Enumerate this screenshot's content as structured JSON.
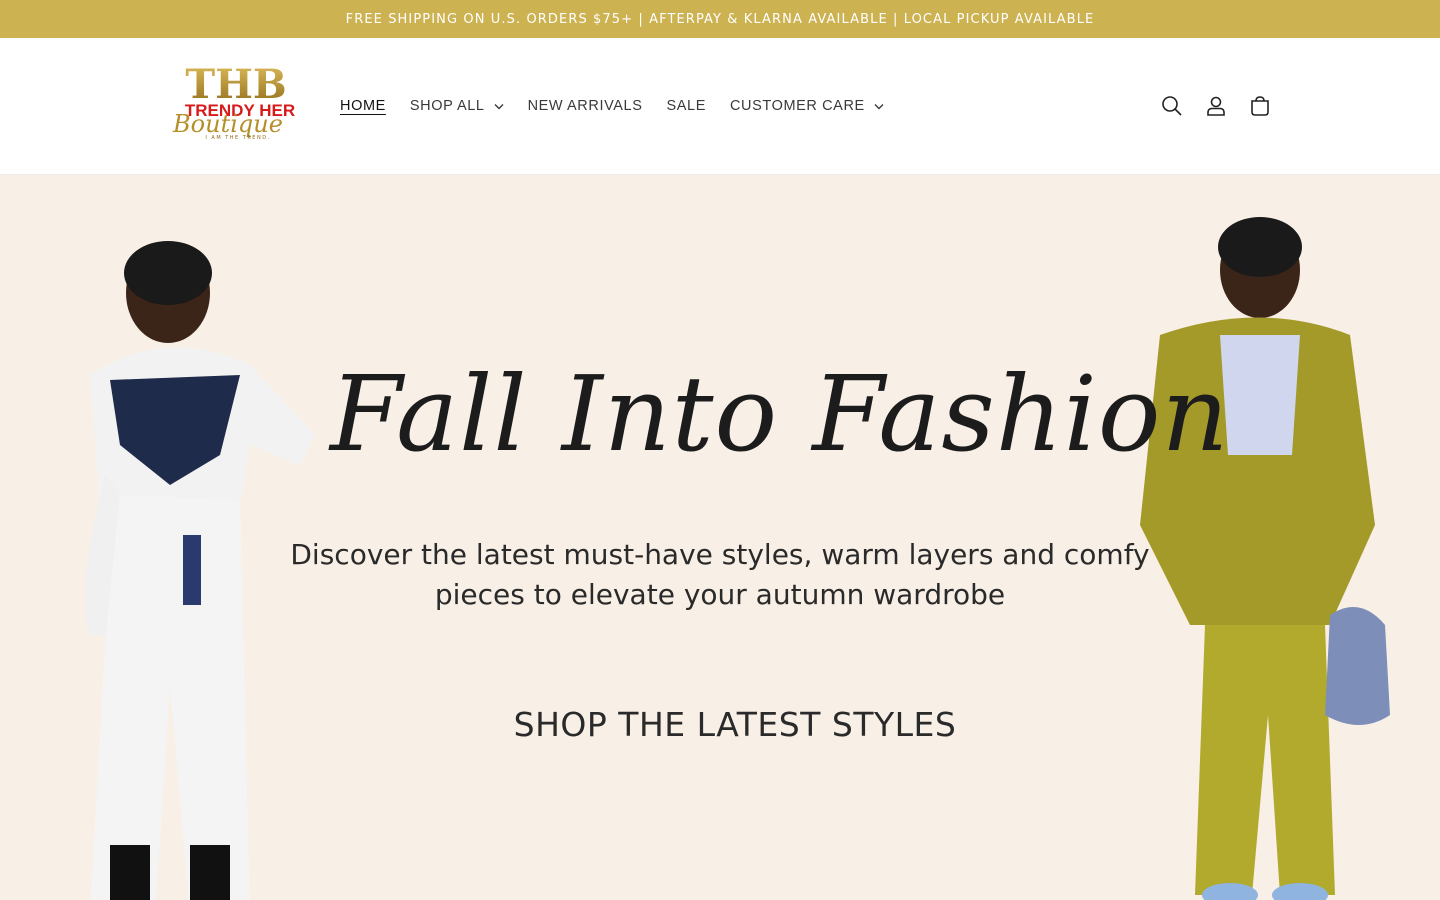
{
  "announcement": {
    "text": "FREE SHIPPING ON U.S. ORDERS $75+  | AFTERPAY & KLARNA AVAILABLE  | LOCAL PICKUP AVAILABLE",
    "background": "#cdb252"
  },
  "logo": {
    "monogram": "THB",
    "name": "TRENDY HER",
    "script": "Boutique",
    "tagline": "I AM THE TREND.",
    "gold": "#b58f2a",
    "red": "#d71a1a"
  },
  "nav": {
    "items": [
      {
        "label": "HOME",
        "active": true,
        "has_dropdown": false
      },
      {
        "label": "SHOP ALL",
        "active": false,
        "has_dropdown": true
      },
      {
        "label": "NEW ARRIVALS",
        "active": false,
        "has_dropdown": false
      },
      {
        "label": "SALE",
        "active": false,
        "has_dropdown": false
      },
      {
        "label": "CUSTOMER CARE",
        "active": false,
        "has_dropdown": true
      }
    ]
  },
  "header_icons": [
    "search-icon",
    "account-icon",
    "cart-icon"
  ],
  "hero": {
    "title": "Fall Into Fashion",
    "subtitle_line1": "Discover the latest must-have styles, warm layers and comfy",
    "subtitle_line2": "pieces to elevate your autumn wardrobe",
    "cta": "SHOP THE LATEST STYLES",
    "background": "#f8efe6"
  }
}
